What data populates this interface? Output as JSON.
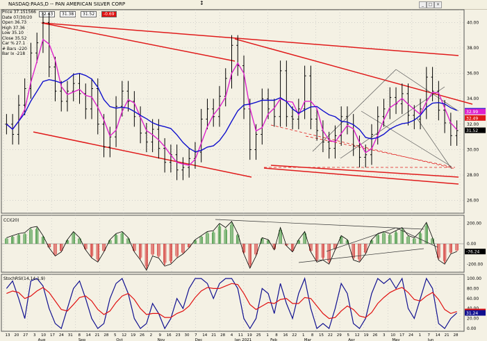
{
  "window": {
    "title": "NASDAQ:PAAS,D -- PAN AMERICAN SILVER CORP",
    "price_boxes": [
      "32.43",
      "31.38",
      "31.52",
      "-0.69"
    ]
  },
  "info": {
    "lines": [
      "Price  37.151566",
      "Date   07/30/20",
      "Open   36.73",
      "High   37.36",
      "Low    35.10",
      "Close  35.52",
      "Car %  27.1",
      "# Bars -220",
      "Bar Ix -218"
    ]
  },
  "price_axis": {
    "ticks": [
      "40.00",
      "38.00",
      "36.00",
      "34.00",
      "32.00",
      "30.00",
      "28.00",
      "26.00"
    ]
  },
  "cci_axis": {
    "ticks": [
      "200.00",
      "0.00",
      "-200.00"
    ]
  },
  "stoch_axis": {
    "ticks": [
      "100.00",
      "80.00",
      "60.00",
      "40.00",
      "20.00",
      "0.00"
    ]
  },
  "tags": {
    "price_blue": "33.05",
    "price_pink": "32.99",
    "price_red": "32.49",
    "price_black": "31.52",
    "cci": "-76.24",
    "stoch_red": "33.96",
    "stoch_blue": "31.24"
  },
  "panel_labels": {
    "cci": "CCI(20)",
    "stoch": "StochRSI(14,14,1,9)"
  },
  "x_axis": {
    "days": [
      "13",
      "20",
      "27",
      "3",
      "10",
      "17",
      "24",
      "31",
      "8",
      "14",
      "21",
      "28",
      "5",
      "12",
      "19",
      "26",
      "2",
      "9",
      "16",
      "23",
      "30",
      "7",
      "14",
      "21",
      "28",
      "4",
      "11",
      "19",
      "25",
      "1",
      "8",
      "16",
      "22",
      "1",
      "8",
      "15",
      "22",
      "29",
      "5",
      "12",
      "19",
      "26",
      "3",
      "10",
      "17",
      "24",
      "1",
      "7",
      "14",
      "21",
      "28"
    ],
    "months": [
      "Aug",
      "Sep",
      "Oct",
      "Nov",
      "Dec",
      "Jan 2021",
      "Feb",
      "Mar",
      "Apr",
      "May",
      "Jun"
    ]
  },
  "colors": {
    "background": "#f4f1e4",
    "bars": "#000000",
    "ma_fast": "#dd22cc",
    "ma_slow": "#1010cc",
    "channel": "#e01a1a",
    "cci_pos": "#2a8a2a",
    "cci_neg": "#d02020",
    "stoch_fast": "#101090",
    "stoch_slow": "#e01010"
  },
  "chart_data": [
    {
      "type": "line",
      "title": "NASDAQ:PAAS,D -- PAN AMERICAN SILVER CORP",
      "ylim": [
        25,
        41
      ],
      "grid": true,
      "series": [
        {
          "name": "Close",
          "values": [
            32.0,
            31.2,
            33.5,
            34.8,
            37.6,
            38.4,
            40.0,
            36.5,
            34.6,
            33.8,
            34.6,
            35.2,
            34.4,
            33.2,
            34.8,
            32.0,
            30.2,
            31.0,
            33.4,
            34.6,
            33.8,
            32.6,
            31.3,
            30.6,
            31.6,
            30.1,
            29.0,
            29.6,
            28.4,
            28.6,
            29.3,
            29.8,
            32.4,
            33.2,
            32.6,
            34.2,
            35.6,
            38.2,
            36.6,
            33.2,
            30.0,
            31.2,
            34.0,
            33.2,
            32.6,
            36.2,
            32.6,
            32.4,
            33.2,
            35.8,
            32.4,
            31.5,
            30.6,
            30.1,
            31.1,
            32.6,
            32.0,
            30.3,
            29.4,
            29.6,
            31.2,
            32.6,
            33.2,
            34.1,
            33.6,
            34.4,
            32.7,
            32.4,
            33.2,
            35.7,
            34.6,
            33.1,
            32.1,
            31.1,
            31.5
          ]
        }
      ]
    },
    {
      "type": "bar",
      "title": "CCI(20)",
      "ylim": [
        -280,
        280
      ],
      "series": [
        {
          "name": "CCI(20)",
          "values": [
            60,
            80,
            100,
            110,
            160,
            170,
            80,
            -40,
            -120,
            -80,
            40,
            120,
            60,
            -60,
            -140,
            -180,
            -80,
            40,
            100,
            120,
            60,
            -80,
            -160,
            -260,
            -120,
            -140,
            -220,
            -200,
            -140,
            -100,
            -40,
            40,
            80,
            120,
            130,
            200,
            160,
            220,
            100,
            -100,
            -240,
            -120,
            60,
            40,
            -60,
            160,
            -20,
            -80,
            40,
            120,
            -80,
            -180,
            -160,
            -200,
            -60,
            80,
            40,
            -160,
            -180,
            -100,
            40,
            100,
            120,
            100,
            130,
            160,
            80,
            60,
            120,
            210,
            60,
            -160,
            -200,
            -100,
            -76
          ]
        }
      ]
    },
    {
      "type": "line",
      "title": "StochRSI(14,14,1,9)",
      "ylim": [
        0,
        100
      ],
      "series": [
        {
          "name": "StochRSI",
          "values": [
            80,
            95,
            60,
            20,
            95,
            100,
            85,
            40,
            10,
            0,
            40,
            80,
            95,
            60,
            20,
            0,
            10,
            60,
            90,
            100,
            70,
            20,
            0,
            10,
            50,
            30,
            0,
            20,
            60,
            40,
            80,
            100,
            100,
            90,
            60,
            90,
            100,
            100,
            80,
            20,
            0,
            20,
            80,
            70,
            30,
            90,
            50,
            20,
            70,
            100,
            40,
            0,
            10,
            0,
            40,
            90,
            70,
            10,
            0,
            20,
            70,
            100,
            90,
            100,
            80,
            100,
            40,
            20,
            60,
            100,
            80,
            10,
            0,
            20,
            31.24
          ]
        },
        {
          "name": "Signal",
          "values": [
            70,
            75,
            72,
            60,
            65,
            75,
            82,
            72,
            55,
            38,
            35,
            48,
            62,
            65,
            55,
            38,
            28,
            35,
            52,
            65,
            70,
            58,
            40,
            28,
            30,
            30,
            22,
            22,
            30,
            35,
            45,
            62,
            75,
            82,
            80,
            80,
            85,
            90,
            88,
            70,
            48,
            38,
            45,
            52,
            50,
            58,
            60,
            50,
            50,
            62,
            60,
            45,
            30,
            20,
            22,
            35,
            45,
            38,
            25,
            22,
            32,
            50,
            62,
            72,
            78,
            82,
            72,
            58,
            55,
            65,
            72,
            58,
            38,
            30,
            33.96
          ]
        }
      ]
    }
  ]
}
